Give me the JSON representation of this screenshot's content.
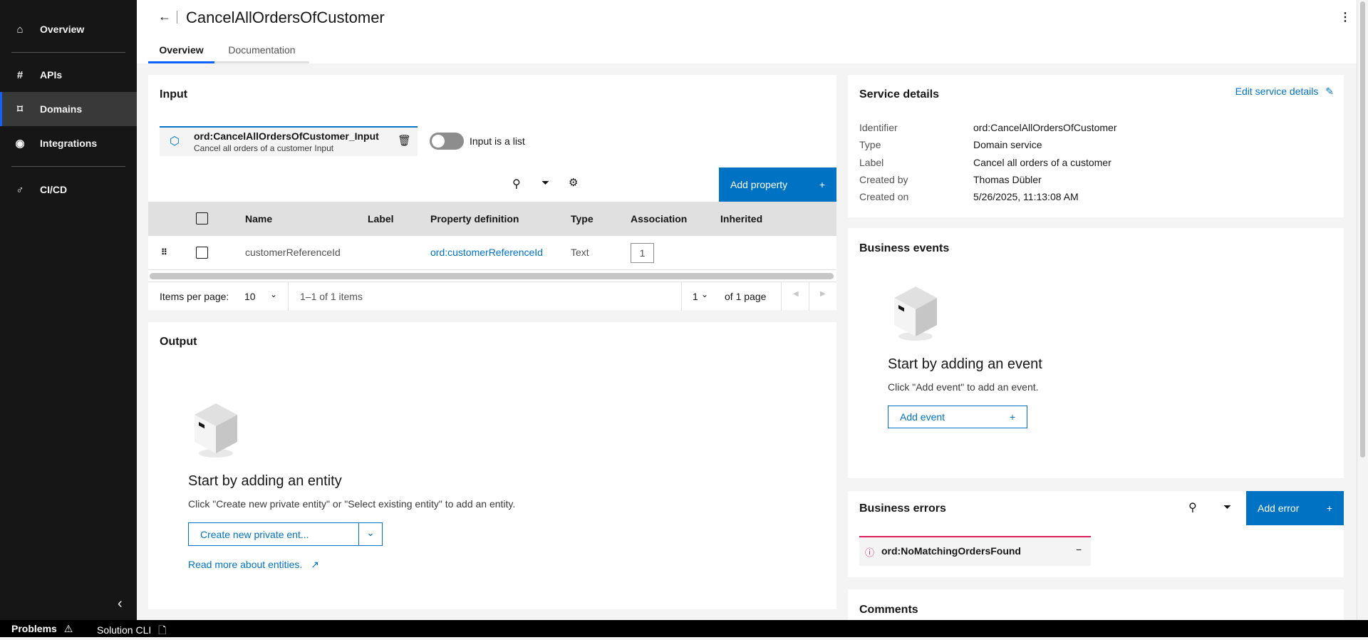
{
  "sidebar": {
    "items": [
      {
        "label": "Overview",
        "icon": "home-icon"
      },
      {
        "label": "APIs",
        "icon": "hash-icon"
      },
      {
        "label": "Domains",
        "icon": "domain-icon",
        "active": true
      },
      {
        "label": "Integrations",
        "icon": "radio-icon"
      },
      {
        "label": "CI/CD",
        "icon": "cicd-icon"
      }
    ]
  },
  "header": {
    "title": "CancelAllOrdersOfCustomer",
    "tabs": [
      {
        "label": "Overview",
        "active": true
      },
      {
        "label": "Documentation"
      }
    ]
  },
  "input": {
    "title": "Input",
    "card_name": "ord:CancelAllOrdersOfCustomer_Input",
    "card_desc": "Cancel all orders of a customer Input",
    "toggle_label": "Input is a list",
    "toggle_on": false,
    "add_property": "Add property",
    "columns": [
      "Name",
      "Label",
      "Property definition",
      "Type",
      "Association",
      "Inherited"
    ],
    "rows": [
      {
        "name": "customerReferenceId",
        "label": "",
        "definition": "ord:customerReferenceId",
        "type": "Text",
        "association": "1",
        "inherited": ""
      }
    ],
    "pagination": {
      "items_per_page_label": "Items per page:",
      "items_per_page": "10",
      "range": "1–1 of 1 items",
      "page": "1",
      "of_pages": "of 1 page"
    }
  },
  "output": {
    "title": "Output",
    "empty_title": "Start by adding an entity",
    "empty_desc": "Click \"Create new private entity\" or \"Select existing entity\" to add an entity.",
    "create_button": "Create new private ent...",
    "read_more": "Read more about entities."
  },
  "service_details": {
    "title": "Service details",
    "edit_link": "Edit service details",
    "rows": [
      {
        "key": "Identifier",
        "value": "ord:CancelAllOrdersOfCustomer"
      },
      {
        "key": "Type",
        "value": "Domain service"
      },
      {
        "key": "Label",
        "value": "Cancel all orders of a customer"
      },
      {
        "key": "Created by",
        "value": "Thomas Dübler"
      },
      {
        "key": "Created on",
        "value": "5/26/2025, 11:13:08 AM"
      }
    ]
  },
  "business_events": {
    "title": "Business events",
    "empty_title": "Start by adding an event",
    "empty_desc": "Click \"Add event\" to add an event.",
    "add_button": "Add event"
  },
  "business_errors": {
    "title": "Business errors",
    "add_button": "Add error",
    "errors": [
      {
        "name": "ord:NoMatchingOrdersFound"
      }
    ]
  },
  "comments": {
    "title": "Comments"
  },
  "bottom_bar": {
    "problems": "Problems",
    "solution_cli": "Solution CLI"
  },
  "colors": {
    "accent": "#0072c3",
    "sidebar": "#161616",
    "error": "#da1e5a"
  }
}
